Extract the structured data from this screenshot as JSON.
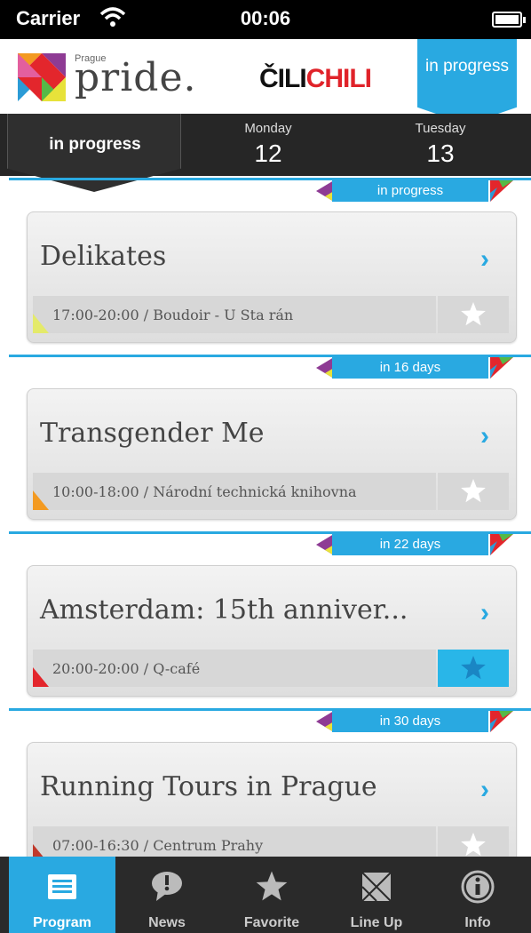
{
  "status_bar": {
    "carrier": "Carrier",
    "time": "00:06"
  },
  "header": {
    "logo_small": "Prague",
    "logo_text": "pride.",
    "sponsor_part1": "ČILI",
    "sponsor_part2": "CHILI",
    "badge": "in progress"
  },
  "date_bar": {
    "current_label": "in progress",
    "days": [
      {
        "name": "Monday",
        "num": "12"
      },
      {
        "name": "Tuesday",
        "num": "13"
      }
    ]
  },
  "events": [
    {
      "countdown": "in progress",
      "title": "Delikates",
      "meta": "17:00-20:00 / Boudoir - U Sta rán",
      "favorite": false,
      "corner_color": "#e4ea6a"
    },
    {
      "countdown": "in 16 days",
      "title": "Transgender Me",
      "meta": "10:00-18:00 / Národní technická knihovna",
      "favorite": false,
      "corner_color": "#f39a21"
    },
    {
      "countdown": "in 22 days",
      "title": "Amsterdam: 15th anniver...",
      "meta": "20:00-20:00 / Q-café",
      "favorite": true,
      "corner_color": "#e3262c"
    },
    {
      "countdown": "in 30 days",
      "title": "Running Tours in Prague",
      "meta": "07:00-16:30 / Centrum Prahy",
      "favorite": false,
      "corner_color": "#c0392b"
    }
  ],
  "tabbar": {
    "tabs": [
      {
        "label": "Program",
        "icon": "list-icon",
        "active": true
      },
      {
        "label": "News",
        "icon": "speech-bubble-icon",
        "active": false
      },
      {
        "label": "Favorite",
        "icon": "star-icon",
        "active": false
      },
      {
        "label": "Line Up",
        "icon": "lineup-icon",
        "active": false
      },
      {
        "label": "Info",
        "icon": "info-icon",
        "active": false
      }
    ]
  },
  "colors": {
    "accent": "#29a9e1",
    "dark": "#262626",
    "sponsor_red": "#e0232a"
  }
}
